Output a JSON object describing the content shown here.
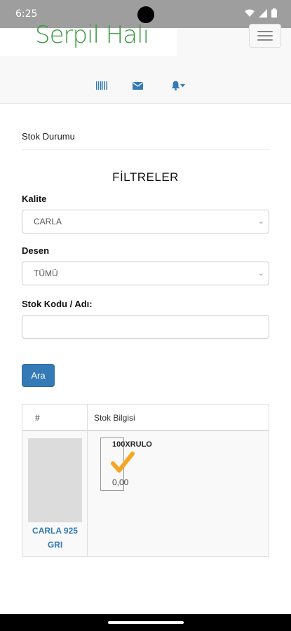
{
  "status": {
    "time": "6:25"
  },
  "header": {
    "logo": "Serpil Halı"
  },
  "page": {
    "title": "Stok Durumu"
  },
  "filters": {
    "heading": "FİLTRELER",
    "quality_label": "Kalite",
    "quality_value": "CARLA",
    "pattern_label": "Desen",
    "pattern_value": "TÜMÜ",
    "code_label": "Stok Kodu / Adı:",
    "code_value": ""
  },
  "search_button": "Ara",
  "table": {
    "headers": [
      "#",
      "Stok Bilgisi"
    ],
    "rows": [
      {
        "name_line1": "CARLA 925",
        "name_line2": "GRI",
        "size": "100XRULO",
        "quantity": "0,00"
      }
    ]
  },
  "icons": {
    "barcode": "barcode-icon",
    "mail": "envelope-icon",
    "bell": "bell-icon",
    "check": "check-icon"
  },
  "colors": {
    "brand_green": "#3a9a3e",
    "primary_blue": "#337ab7",
    "check_orange": "#f5a623"
  }
}
